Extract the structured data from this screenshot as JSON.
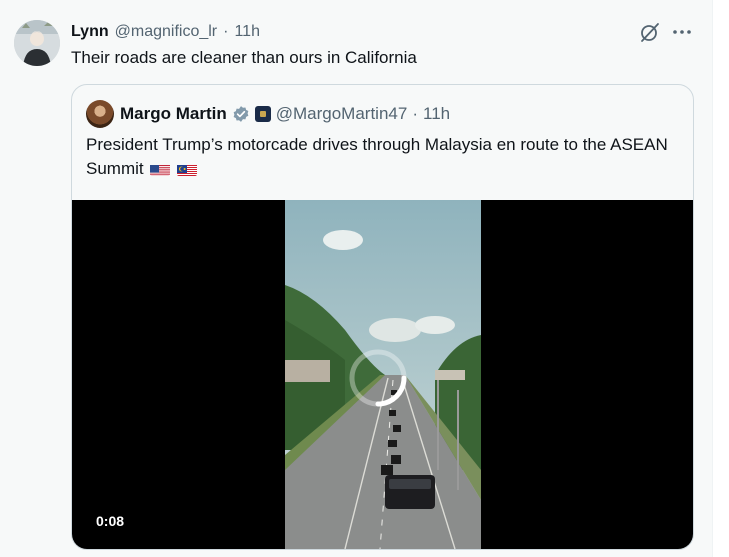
{
  "tweet": {
    "display_name": "Lynn",
    "handle": "@magnifico_lr",
    "separator": "·",
    "time": "11h",
    "text": "Their roads are cleaner than ours in California"
  },
  "quoted": {
    "display_name": "Margo Martin",
    "handle": "@MargoMartin47",
    "separator": "·",
    "time": "11h",
    "text": "President Trump’s motorcade drives through Malaysia en route to the ASEAN Summit",
    "flags": [
      "us-flag-icon",
      "malaysia-flag-icon"
    ],
    "video": {
      "duration": "0:08"
    }
  },
  "icons": {
    "grok": "grok-icon",
    "more": "more-icon",
    "verified": "verified-badge-icon"
  },
  "colors": {
    "text": "#0f1419",
    "secondary": "#536471",
    "border": "#cfd9de",
    "verified": "#829aab"
  }
}
